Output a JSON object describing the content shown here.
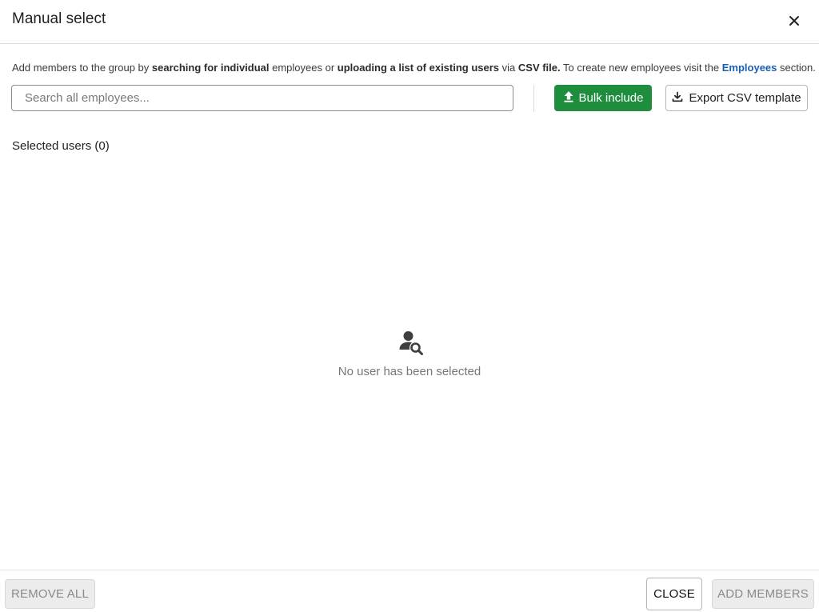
{
  "dialog": {
    "title": "Manual select",
    "close_icon": "close-icon"
  },
  "description": {
    "part1": "Add members to the group by ",
    "bold1": "searching for individual",
    "part2": " employees or ",
    "bold2": "uploading a list of existing users",
    "part3": " via ",
    "bold3": "CSV file.",
    "part4": " To create new employees visit the ",
    "link": "Employees",
    "part5": " section."
  },
  "search": {
    "placeholder": "Search all employees...",
    "value": ""
  },
  "toolbar": {
    "bulk_include_label": "Bulk include",
    "bulk_include_icon": "upload-icon",
    "export_label": "Export CSV template",
    "export_icon": "download-icon"
  },
  "selected": {
    "label": "Selected users (0)"
  },
  "empty_state": {
    "icon": "user-search-icon",
    "text": "No user has been selected"
  },
  "footer": {
    "remove_all_label": "REMOVE ALL",
    "close_label": "CLOSE",
    "add_members_label": "ADD MEMBERS"
  },
  "colors": {
    "primary_green": "#1e8e3e",
    "link_blue": "#1a5fb4",
    "disabled_bg": "#ececec"
  }
}
